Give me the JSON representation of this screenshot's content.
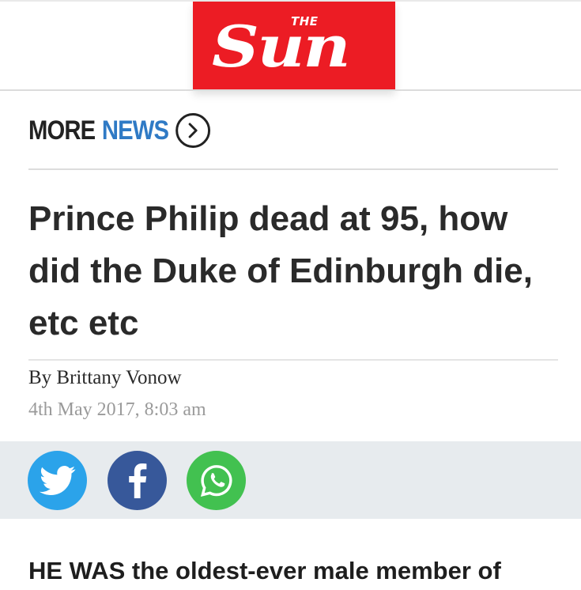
{
  "brand": {
    "logo_small": "THE",
    "logo_main": "Sun",
    "accent_color": "#ec1c24"
  },
  "section": {
    "more_label": "MORE",
    "news_label": "NEWS",
    "news_color": "#2f7ac5",
    "link_icon": "chevron-right-circle-icon"
  },
  "article": {
    "headline": "Prince Philip dead at 95, how did the Duke of Edinburgh die, etc etc",
    "byline": "By Brittany Vonow",
    "date": "4th May 2017, 8:03 am",
    "lede": "HE WAS the oldest-ever male member of"
  },
  "share": {
    "buttons": [
      {
        "icon": "twitter-icon",
        "color": "#2ba3ea"
      },
      {
        "icon": "facebook-icon",
        "color": "#37589a"
      },
      {
        "icon": "whatsapp-icon",
        "color": "#42c150"
      }
    ]
  }
}
